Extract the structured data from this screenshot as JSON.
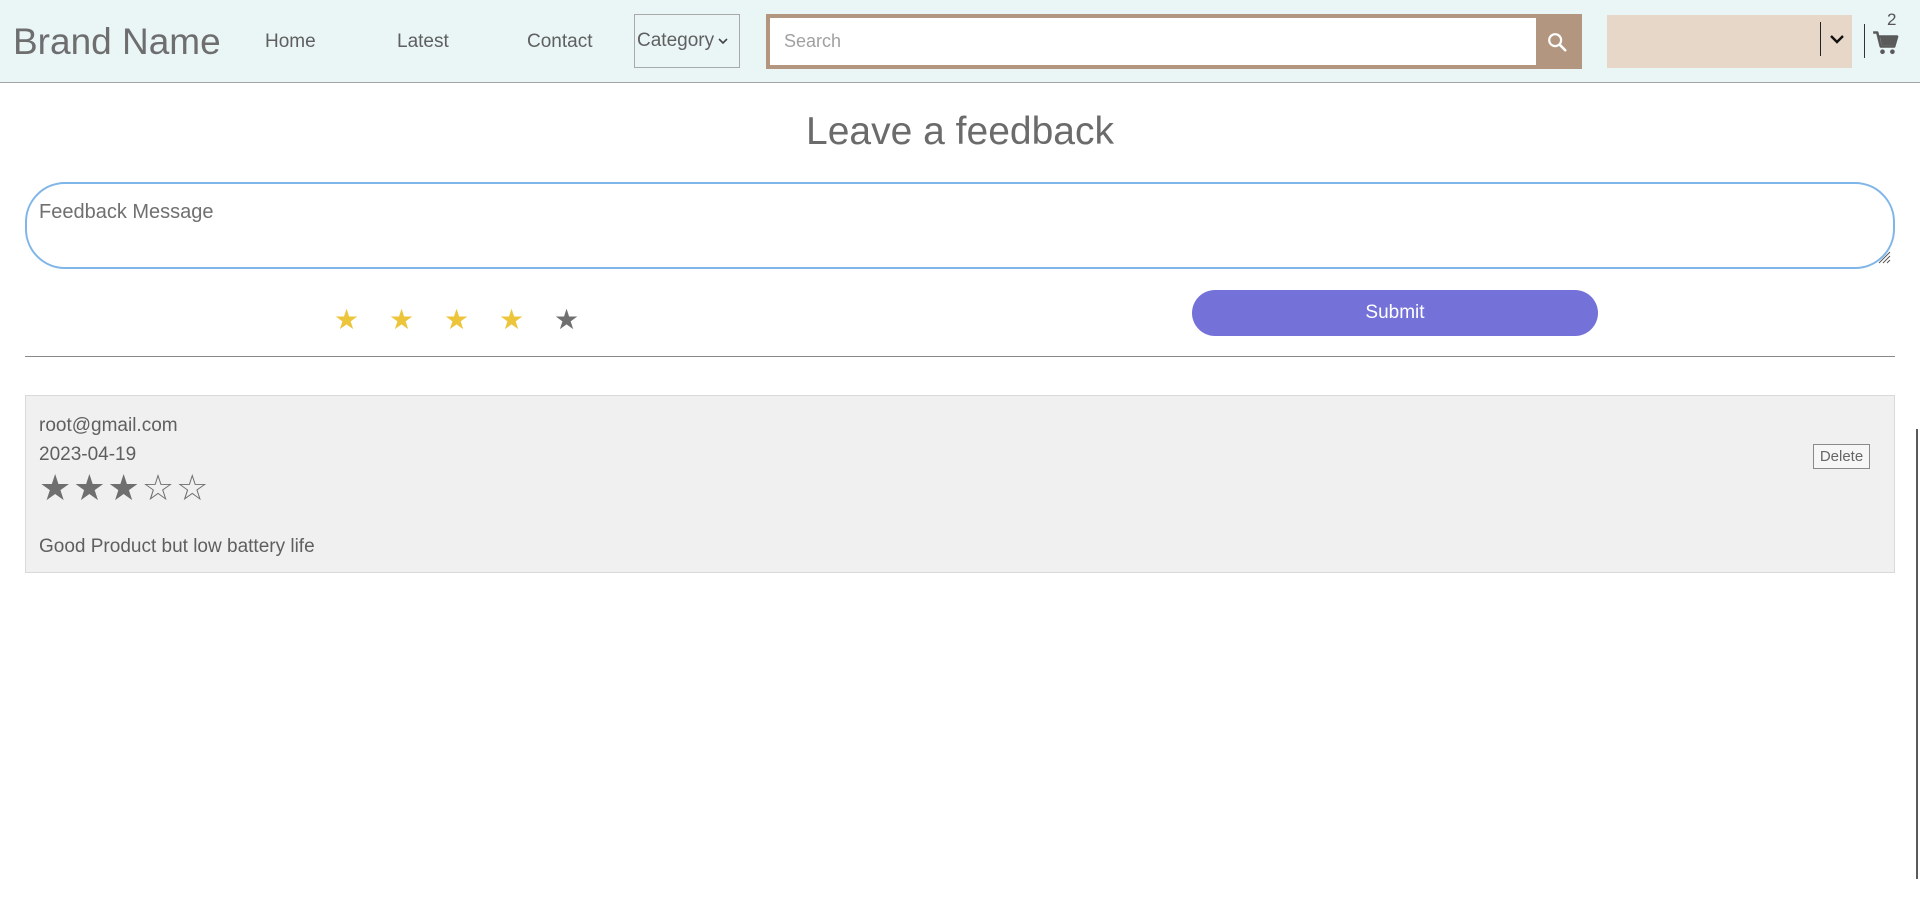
{
  "navbar": {
    "brand": "Brand Name",
    "links": [
      {
        "label": "Home"
      },
      {
        "label": "Latest"
      },
      {
        "label": "Contact"
      }
    ],
    "category_label": "Category",
    "search_placeholder": "Search",
    "user_dropdown_value": "",
    "cart_count": "2"
  },
  "feedback_form": {
    "title": "Leave a feedback",
    "message_placeholder": "Feedback Message",
    "rating_selected": 4,
    "rating_max": 5,
    "submit_label": "Submit"
  },
  "reviews": [
    {
      "email": "root@gmail.com",
      "date": "2023-04-19",
      "rating": 3,
      "rating_max": 5,
      "stars_text": "★★★☆☆",
      "text": "Good Product but low battery life",
      "delete_label": "Delete"
    }
  ],
  "colors": {
    "navbar_bg": "#eaf6f6",
    "search_accent": "#b39680",
    "user_dropdown_bg": "#e6d7c9",
    "submit_bg": "#7472d8",
    "star_active": "#ecc53b",
    "star_inactive": "#707070",
    "textarea_border": "#7fb5e8",
    "card_bg": "#f0f0f0"
  },
  "icons": {
    "category_dropdown": "chevron-down-icon",
    "search": "search-icon",
    "user_dropdown": "chevron-down-icon",
    "cart": "shopping-cart-icon",
    "rating": "star-icon"
  }
}
